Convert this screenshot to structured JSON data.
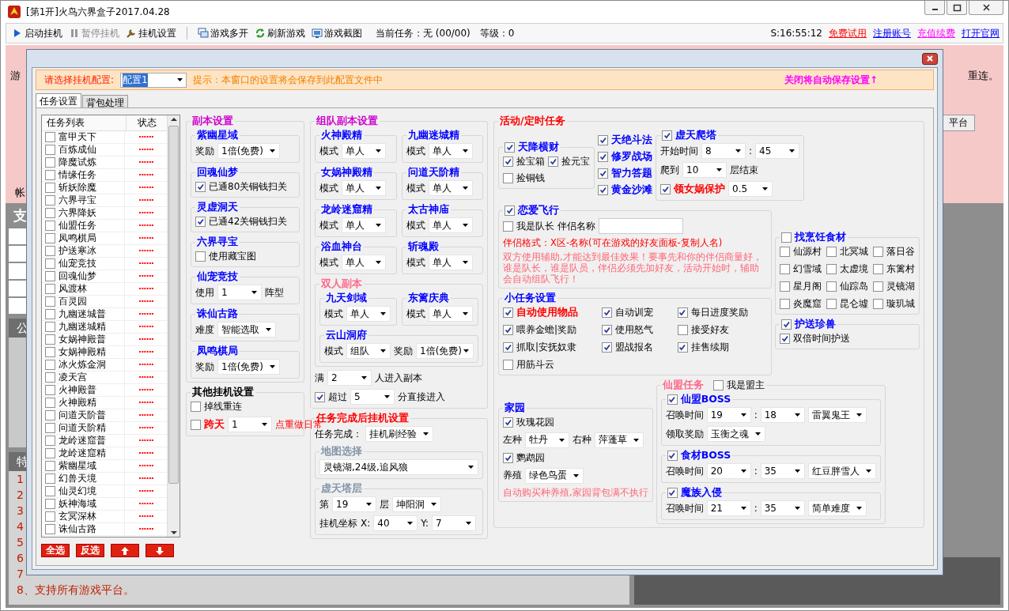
{
  "window": {
    "title": "[第1开]火鸟六界盒子2017.04.28"
  },
  "toolbar": {
    "buttons": [
      {
        "label": "启动挂机",
        "disabled": false
      },
      {
        "label": "暂停挂机",
        "disabled": true
      },
      {
        "label": "挂机设置",
        "disabled": false
      },
      {
        "label": "游戏多开",
        "disabled": false
      },
      {
        "label": "刷新游戏",
        "disabled": false
      },
      {
        "label": "游戏截图",
        "disabled": false
      }
    ],
    "task": "当前任务：无 (00/00)",
    "level": "等级：0",
    "clock": "S:16:55:12",
    "links": [
      {
        "label": "免费试用",
        "color": "#ff0000"
      },
      {
        "label": "注册账号",
        "color": "#0000ff"
      },
      {
        "label": "充值续费",
        "color": "#ff00ff"
      },
      {
        "label": "打开官网",
        "color": "#0000ff"
      }
    ]
  },
  "background": {
    "table_header": "游",
    "note": "重连。",
    "button": "平台",
    "account_label": "帐",
    "section_title": "支",
    "panel_1_title": "公",
    "panel_2_title": "特",
    "list": [
      "1",
      "2",
      "3",
      "4",
      "5",
      "6",
      "7",
      "8、支持所有游戏平台。"
    ]
  },
  "dialog": {
    "config_label": "请选择挂机配置:",
    "config_value": "配置1",
    "hint": "提示：本窗口的设置将会保存到此配置文件中",
    "autosave": "关闭将自动保存设置↑",
    "tabs": [
      {
        "label": "任务设置",
        "selected": true
      },
      {
        "label": "背包处理",
        "selected": false
      }
    ],
    "task_list": {
      "columns": [
        "任务列表",
        "状态"
      ],
      "rows": [
        {
          "name": "富甲天下",
          "checked": false,
          "status": "······"
        },
        {
          "name": "百炼成仙",
          "checked": false,
          "status": "······"
        },
        {
          "name": "降魔试炼",
          "checked": false,
          "status": "······"
        },
        {
          "name": "情缘任务",
          "checked": false,
          "status": "······"
        },
        {
          "name": "斩妖除魔",
          "checked": false,
          "status": "······"
        },
        {
          "name": "六界寻宝",
          "checked": false,
          "status": "······"
        },
        {
          "name": "六界降妖",
          "checked": false,
          "status": "······"
        },
        {
          "name": "仙盟任务",
          "checked": false,
          "status": "······"
        },
        {
          "name": "凤鸣棋局",
          "checked": false,
          "status": "······"
        },
        {
          "name": "护送寒冰",
          "checked": false,
          "status": "······"
        },
        {
          "name": "仙宠竞技",
          "checked": false,
          "status": "······"
        },
        {
          "name": "回魂仙梦",
          "checked": false,
          "status": "······"
        },
        {
          "name": "风渡林",
          "checked": false,
          "status": "······"
        },
        {
          "name": "百灵园",
          "checked": false,
          "status": "······"
        },
        {
          "name": "九幽迷城普",
          "checked": false,
          "status": "······"
        },
        {
          "name": "九幽迷城精",
          "checked": false,
          "status": "······"
        },
        {
          "name": "女娲神殿普",
          "checked": false,
          "status": "······"
        },
        {
          "name": "女娲神殿精",
          "checked": false,
          "status": "······"
        },
        {
          "name": "冰火炼金洞",
          "checked": false,
          "status": "······"
        },
        {
          "name": "凌天宫",
          "checked": false,
          "status": "······"
        },
        {
          "name": "火神殿普",
          "checked": false,
          "status": "······"
        },
        {
          "name": "火神殿精",
          "checked": false,
          "status": "······"
        },
        {
          "name": "问道天阶普",
          "checked": false,
          "status": "······"
        },
        {
          "name": "问道天阶精",
          "checked": false,
          "status": "······"
        },
        {
          "name": "龙岭迷窟普",
          "checked": false,
          "status": "······"
        },
        {
          "name": "龙岭迷窟精",
          "checked": false,
          "status": "······"
        },
        {
          "name": "紫幽星域",
          "checked": false,
          "status": "······"
        },
        {
          "name": "幻兽天境",
          "checked": false,
          "status": "······"
        },
        {
          "name": "仙灵幻境",
          "checked": false,
          "status": "······"
        },
        {
          "name": "妖神海域",
          "checked": false,
          "status": "······"
        },
        {
          "name": "玄冥深林",
          "checked": false,
          "status": "······"
        },
        {
          "name": "诛仙古路",
          "checked": false,
          "status": "······"
        }
      ]
    },
    "list_buttons": [
      {
        "kind": "text",
        "label": "全选"
      },
      {
        "kind": "text",
        "label": "反选"
      },
      {
        "kind": "up"
      },
      {
        "kind": "down"
      }
    ],
    "columns": [
      [
        {
          "kind": "group",
          "title": "副本设置",
          "color": "#cc00cc",
          "children": [
            {
              "kind": "group",
              "title": "紫幽星域",
              "color": "#0000ff",
              "children": [
                {
                  "kind": "row",
                  "children": [
                    {
                      "kind": "label",
                      "text": "奖励"
                    },
                    {
                      "kind": "combo",
                      "value": "1倍(免费)"
                    }
                  ]
                }
              ]
            },
            {
              "kind": "group",
              "title": "回魂仙梦",
              "color": "#0000ff",
              "children": [
                {
                  "kind": "check",
                  "label": "已通80关铜钱扫关",
                  "checked": true
                }
              ]
            },
            {
              "kind": "group",
              "title": "灵虚洞天",
              "color": "#0000ff",
              "children": [
                {
                  "kind": "check",
                  "label": "已通42关铜钱扫关",
                  "checked": true
                }
              ]
            },
            {
              "kind": "group",
              "title": "六界寻宝",
              "color": "#0000ff",
              "children": [
                {
                  "kind": "check",
                  "label": "使用藏宝图",
                  "checked": false
                }
              ]
            },
            {
              "kind": "group",
              "title": "仙宠竞技",
              "color": "#0000ff",
              "children": [
                {
                  "kind": "row",
                  "children": [
                    {
                      "kind": "label",
                      "text": "使用"
                    },
                    {
                      "kind": "combo",
                      "value": "1"
                    },
                    {
                      "kind": "label",
                      "text": "阵型"
                    }
                  ]
                }
              ]
            },
            {
              "kind": "group",
              "title": "诛仙古路",
              "color": "#0000ff",
              "children": [
                {
                  "kind": "row",
                  "children": [
                    {
                      "kind": "label",
                      "text": "难度"
                    },
                    {
                      "kind": "combo",
                      "value": "智能选取"
                    }
                  ]
                }
              ]
            },
            {
              "kind": "group",
              "title": "凤鸣棋局",
              "color": "#0000ff",
              "children": [
                {
                  "kind": "row",
                  "children": [
                    {
                      "kind": "label",
                      "text": "奖励"
                    },
                    {
                      "kind": "combo",
                      "value": "1倍(免费)"
                    }
                  ]
                }
              ]
            }
          ]
        },
        {
          "kind": "group",
          "title": "其他挂机设置",
          "color": "#000000",
          "children": [
            {
              "kind": "check",
              "label": "掉线重连",
              "checked": false
            },
            {
              "kind": "row",
              "children": [
                {
                  "kind": "check",
                  "label": "跨天",
                  "checked": false,
                  "color": "#ff0000"
                },
                {
                  "kind": "combo",
                  "value": "1"
                },
                {
                  "kind": "label",
                  "text": "点重做日常",
                  "color": "#ff0000"
                }
              ]
            }
          ]
        }
      ],
      [
        {
          "kind": "group",
          "title": "组队副本设置",
          "color": "#cc00cc",
          "children": [
            {
              "kind": "grid2",
              "children": [
                {
                  "kind": "group",
                  "title": "火神殿精",
                  "color": "#0000ff",
                  "children": [
                    {
                      "kind": "row",
                      "children": [
                        {
                          "kind": "label",
                          "text": "模式"
                        },
                        {
                          "kind": "combo",
                          "value": "单人"
                        }
                      ]
                    }
                  ]
                },
                {
                  "kind": "group",
                  "title": "九幽迷城精",
                  "color": "#0000ff",
                  "children": [
                    {
                      "kind": "row",
                      "children": [
                        {
                          "kind": "label",
                          "text": "模式"
                        },
                        {
                          "kind": "combo",
                          "value": "单人"
                        }
                      ]
                    }
                  ]
                },
                {
                  "kind": "group",
                  "title": "女娲神殿精",
                  "color": "#0000ff",
                  "children": [
                    {
                      "kind": "row",
                      "children": [
                        {
                          "kind": "label",
                          "text": "模式"
                        },
                        {
                          "kind": "combo",
                          "value": "单人"
                        }
                      ]
                    }
                  ]
                },
                {
                  "kind": "group",
                  "title": "问道天阶精",
                  "color": "#0000ff",
                  "children": [
                    {
                      "kind": "row",
                      "children": [
                        {
                          "kind": "label",
                          "text": "模式"
                        },
                        {
                          "kind": "combo",
                          "value": "单人"
                        }
                      ]
                    }
                  ]
                },
                {
                  "kind": "group",
                  "title": "龙岭迷窟精",
                  "color": "#0000ff",
                  "children": [
                    {
                      "kind": "row",
                      "children": [
                        {
                          "kind": "label",
                          "text": "模式"
                        },
                        {
                          "kind": "combo",
                          "value": "单人"
                        }
                      ]
                    }
                  ]
                },
                {
                  "kind": "group",
                  "title": "太古神庙",
                  "color": "#0000ff",
                  "children": [
                    {
                      "kind": "row",
                      "children": [
                        {
                          "kind": "label",
                          "text": "模式"
                        },
                        {
                          "kind": "combo",
                          "value": "单人"
                        }
                      ]
                    }
                  ]
                },
                {
                  "kind": "group",
                  "title": "浴血神台",
                  "color": "#0000ff",
                  "children": [
                    {
                      "kind": "row",
                      "children": [
                        {
                          "kind": "label",
                          "text": "模式"
                        },
                        {
                          "kind": "combo",
                          "value": "单人"
                        }
                      ]
                    }
                  ]
                },
                {
                  "kind": "group",
                  "title": "斩魂殿",
                  "color": "#0000ff",
                  "children": [
                    {
                      "kind": "row",
                      "children": [
                        {
                          "kind": "label",
                          "text": "模式"
                        },
                        {
                          "kind": "combo",
                          "value": "单人"
                        }
                      ]
                    }
                  ]
                }
              ]
            },
            {
              "kind": "group",
              "title": "双人副本",
              "color": "#ff6688",
              "children": [
                {
                  "kind": "grid2",
                  "children": [
                    {
                      "kind": "group",
                      "title": "九天剑域",
                      "color": "#0000ff",
                      "children": [
                        {
                          "kind": "row",
                          "children": [
                            {
                              "kind": "label",
                              "text": "模式"
                            },
                            {
                              "kind": "combo",
                              "value": "单人"
                            }
                          ]
                        }
                      ]
                    },
                    {
                      "kind": "group",
                      "title": "东篱庆典",
                      "color": "#0000ff",
                      "children": [
                        {
                          "kind": "row",
                          "children": [
                            {
                              "kind": "label",
                              "text": "模式"
                            },
                            {
                              "kind": "combo",
                              "value": "单人"
                            }
                          ]
                        }
                      ]
                    }
                  ]
                },
                {
                  "kind": "group",
                  "title": "云山洞府",
                  "color": "#0000ff",
                  "children": [
                    {
                      "kind": "row",
                      "children": [
                        {
                          "kind": "label",
                          "text": "模式"
                        },
                        {
                          "kind": "combo",
                          "value": "组队"
                        },
                        {
                          "kind": "label",
                          "text": "奖励"
                        },
                        {
                          "kind": "combo",
                          "value": "1倍(免费)"
                        }
                      ]
                    }
                  ]
                }
              ]
            },
            {
              "kind": "row",
              "children": [
                {
                  "kind": "label",
                  "text": "满"
                },
                {
                  "kind": "combo",
                  "value": "2"
                },
                {
                  "kind": "label",
                  "text": "人进入副本"
                }
              ]
            },
            {
              "kind": "row",
              "children": [
                {
                  "kind": "check",
                  "label": "超过",
                  "checked": true
                },
                {
                  "kind": "combo",
                  "value": "5"
                },
                {
                  "kind": "label",
                  "text": "分直接进入"
                }
              ]
            }
          ]
        },
        {
          "kind": "group",
          "title": "任务完成后挂机设置",
          "color": "#ff0000",
          "children": [
            {
              "kind": "row",
              "children": [
                {
                  "kind": "label",
                  "text": "任务完成："
                },
                {
                  "kind": "combo",
                  "value": "挂机刷经验"
                }
              ]
            },
            {
              "kind": "group",
              "title": "地图选择",
              "color": "#8494a8",
              "children": [
                {
                  "kind": "combo",
                  "value": "灵镜湖,24级,追风狼"
                }
              ]
            },
            {
              "kind": "group",
              "title": "虚天塔层",
              "color": "#8494a8",
              "children": [
                {
                  "kind": "row",
                  "children": [
                    {
                      "kind": "label",
                      "text": "第"
                    },
                    {
                      "kind": "combo",
                      "value": "19"
                    },
                    {
                      "kind": "label",
                      "text": "层"
                    },
                    {
                      "kind": "combo",
                      "value": "坤阳洞"
                    }
                  ]
                },
                {
                  "kind": "row",
                  "children": [
                    {
                      "kind": "label",
                      "text": "挂机坐标"
                    },
                    {
                      "kind": "label",
                      "text": "X:"
                    },
                    {
                      "kind": "combo",
                      "value": "40"
                    },
                    {
                      "kind": "label",
                      "text": "Y:"
                    },
                    {
                      "kind": "combo",
                      "value": "7"
                    }
                  ]
                }
              ]
            }
          ]
        }
      ],
      [
        {
          "kind": "group",
          "title": "活动/定时任务",
          "color": "#ff0000",
          "children": [
            {
              "kind": "row",
              "children": [
                {
                  "kind": "group",
                  "title": "天降横财",
                  "color": "#0000ff",
                  "checked": true,
                  "children": [
                    {
                      "kind": "row",
                      "children": [
                        {
                          "kind": "check",
                          "label": "捡宝箱",
                          "checked": true
                        },
                        {
                          "kind": "check",
                          "label": "捡元宝",
                          "checked": true
                        }
                      ]
                    },
                    {
                      "kind": "check",
                      "label": "捡铜钱",
                      "checked": false
                    }
                  ]
                },
                {
                  "kind": "col",
                  "children": [
                    {
                      "kind": "check_strong",
                      "label": "天绝斗法",
                      "checked": true,
                      "color": "#0000ff"
                    },
                    {
                      "kind": "check_strong",
                      "label": "修罗战场",
                      "checked": true,
                      "color": "#0000ff"
                    },
                    {
                      "kind": "check_strong",
                      "label": "智力答题",
                      "checked": true,
                      "color": "#0000ff"
                    },
                    {
                      "kind": "check_strong",
                      "label": "黄金沙滩",
                      "checked": true,
                      "color": "#0000ff"
                    }
                  ]
                },
                {
                  "kind": "group",
                  "title": "虚天爬塔",
                  "color": "#0000ff",
                  "checked": true,
                  "children": [
                    {
                      "kind": "row",
                      "children": [
                        {
                          "kind": "label",
                          "text": "开始时间"
                        },
                        {
                          "kind": "combo",
                          "value": "8"
                        },
                        {
                          "kind": "label",
                          "text": ":"
                        },
                        {
                          "kind": "combo",
                          "value": "45"
                        }
                      ]
                    },
                    {
                      "kind": "row",
                      "children": [
                        {
                          "kind": "label",
                          "text": "爬到"
                        },
                        {
                          "kind": "combo",
                          "value": "10"
                        },
                        {
                          "kind": "label",
                          "text": "层结束"
                        }
                      ]
                    },
                    {
                      "kind": "row",
                      "children": [
                        {
                          "kind": "check",
                          "label": "领女娲保护",
                          "checked": true,
                          "color": "#ff0000"
                        },
                        {
                          "kind": "combo",
                          "value": "0.5"
                        }
                      ]
                    }
                  ]
                }
              ]
            },
            {
              "kind": "row",
              "children": [
                {
                  "kind": "col",
                  "children": [
                    {
                      "kind": "group",
                      "title": "恋爱飞行",
                      "color": "#0000ff",
                      "checked": true,
                      "children": [
                        {
                          "kind": "row",
                          "children": [
                            {
                              "kind": "check",
                              "label": "我是队长",
                              "checked": false
                            },
                            {
                              "kind": "label",
                              "text": "伴侣名称"
                            },
                            {
                              "kind": "field"
                            }
                          ]
                        },
                        {
                          "kind": "note",
                          "text": "伴侣格式：X区-名称(可在游戏的好友面板-复制人名)",
                          "color": "#ff0000"
                        },
                        {
                          "kind": "note",
                          "text": "双方使用辅助,才能达到最佳效果！要事先和你的伴侣商量好，谁是队长，谁是队员，伴侣必须先加好友，活动开始时，辅助会自动组队飞行！",
                          "color": "#ff6677"
                        }
                      ]
                    },
                    {
                      "kind": "group",
                      "title": "小任务设置",
                      "color": "#0000ff",
                      "children": [
                        {
                          "kind": "grid3",
                          "children": [
                            {
                              "kind": "check_strong",
                              "label": "自动使用物品",
                              "checked": true,
                              "color": "#ff0000"
                            },
                            {
                              "kind": "check",
                              "label": "自动训宠",
                              "checked": true
                            },
                            {
                              "kind": "check",
                              "label": "每日进度奖励",
                              "checked": true
                            },
                            {
                              "kind": "check",
                              "label": "喂养金蟾|奖励",
                              "checked": true
                            },
                            {
                              "kind": "check",
                              "label": "使用怒气",
                              "checked": true
                            },
                            {
                              "kind": "check",
                              "label": "接受好友",
                              "checked": false
                            },
                            {
                              "kind": "check",
                              "label": "抓取|安抚奴隶",
                              "checked": true
                            },
                            {
                              "kind": "check",
                              "label": "盟战报名",
                              "checked": true
                            },
                            {
                              "kind": "check",
                              "label": "挂售续期",
                              "checked": true
                            },
                            {
                              "kind": "check",
                              "label": "用筋斗云",
                              "checked": false
                            }
                          ]
                        }
                      ]
                    }
                  ]
                },
                {
                  "kind": "col",
                  "children": [
                    {
                      "kind": "group",
                      "title": "找烹饪食材",
                      "color": "#0000ff",
                      "checked": false,
                      "children": [
                        {
                          "kind": "grid3",
                          "children": [
                            {
                              "kind": "check",
                              "label": "仙源村",
                              "checked": false
                            },
                            {
                              "kind": "check",
                              "label": "北冥城",
                              "checked": false
                            },
                            {
                              "kind": "check",
                              "label": "落日谷",
                              "checked": false
                            },
                            {
                              "kind": "check",
                              "label": "幻雪域",
                              "checked": false
                            },
                            {
                              "kind": "check",
                              "label": "太虚境",
                              "checked": false
                            },
                            {
                              "kind": "check",
                              "label": "东篱村",
                              "checked": false
                            },
                            {
                              "kind": "check",
                              "label": "星月阁",
                              "checked": false
                            },
                            {
                              "kind": "check",
                              "label": "仙踪岛",
                              "checked": false
                            },
                            {
                              "kind": "check",
                              "label": "灵镜湖",
                              "checked": false
                            },
                            {
                              "kind": "check",
                              "label": "炎魔窟",
                              "checked": false
                            },
                            {
                              "kind": "check",
                              "label": "昆仑墟",
                              "checked": false
                            },
                            {
                              "kind": "check",
                              "label": "璇玑城",
                              "checked": false
                            }
                          ]
                        }
                      ]
                    },
                    {
                      "kind": "group",
                      "title": "护送珍兽",
                      "color": "#0000ff",
                      "checked": true,
                      "children": [
                        {
                          "kind": "check",
                          "label": "双倍时间护送",
                          "checked": true
                        }
                      ]
                    }
                  ]
                }
              ]
            },
            {
              "kind": "row",
              "children": [
                {
                  "kind": "group",
                  "title": "家园",
                  "color": "#0000ff",
                  "children": [
                    {
                      "kind": "check",
                      "label": "玫瑰花园",
                      "checked": true
                    },
                    {
                      "kind": "row",
                      "children": [
                        {
                          "kind": "label",
                          "text": "左种"
                        },
                        {
                          "kind": "combo",
                          "value": "牡丹"
                        },
                        {
                          "kind": "label",
                          "text": "右种"
                        },
                        {
                          "kind": "combo",
                          "value": "萍蓬草"
                        }
                      ]
                    },
                    {
                      "kind": "check",
                      "label": "鹦鹉园",
                      "checked": true
                    },
                    {
                      "kind": "row",
                      "children": [
                        {
                          "kind": "label",
                          "text": "养殖"
                        },
                        {
                          "kind": "combo",
                          "value": "绿色鸟蛋"
                        }
                      ]
                    },
                    {
                      "kind": "note",
                      "text": "自动购买种养殖,家园背包满不执行",
                      "color": "#ff6677"
                    }
                  ]
                },
                {
                  "kind": "group",
                  "title": "仙盟任务",
                  "color": "#ff6688",
                  "legend_check": {
                    "label": "我是盟主",
                    "checked": false
                  },
                  "children": [
                    {
                      "kind": "group",
                      "title": "仙盟BOSS",
                      "color": "#0000ff",
                      "checked": true,
                      "children": [
                        {
                          "kind": "row",
                          "children": [
                            {
                              "kind": "label",
                              "text": "召唤时间"
                            },
                            {
                              "kind": "combo",
                              "value": "19"
                            },
                            {
                              "kind": "label",
                              "text": ":"
                            },
                            {
                              "kind": "combo",
                              "value": "18"
                            },
                            {
                              "kind": "combo",
                              "value": "雷翼鬼王"
                            }
                          ]
                        },
                        {
                          "kind": "row",
                          "children": [
                            {
                              "kind": "label",
                              "text": "领取奖励"
                            },
                            {
                              "kind": "combo",
                              "value": "玉衡之魂"
                            }
                          ]
                        }
                      ]
                    },
                    {
                      "kind": "group",
                      "title": "食材BOSS",
                      "color": "#0000ff",
                      "checked": true,
                      "children": [
                        {
                          "kind": "row",
                          "children": [
                            {
                              "kind": "label",
                              "text": "召唤时间"
                            },
                            {
                              "kind": "combo",
                              "value": "20"
                            },
                            {
                              "kind": "label",
                              "text": ":"
                            },
                            {
                              "kind": "combo",
                              "value": "35"
                            },
                            {
                              "kind": "combo",
                              "value": "红豆胖雪人"
                            }
                          ]
                        }
                      ]
                    },
                    {
                      "kind": "group",
                      "title": "魔族入侵",
                      "color": "#0000ff",
                      "checked": true,
                      "children": [
                        {
                          "kind": "row",
                          "children": [
                            {
                              "kind": "label",
                              "text": "召唤时间"
                            },
                            {
                              "kind": "combo",
                              "value": "21"
                            },
                            {
                              "kind": "label",
                              "text": ":"
                            },
                            {
                              "kind": "combo",
                              "value": "35"
                            },
                            {
                              "kind": "combo",
                              "value": "简单难度"
                            }
                          ]
                        }
                      ]
                    }
                  ]
                }
              ]
            }
          ]
        }
      ]
    ]
  }
}
